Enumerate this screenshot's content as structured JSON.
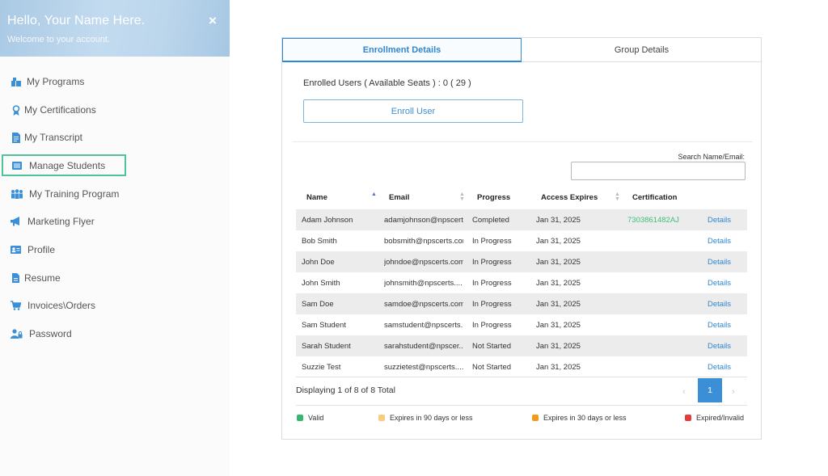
{
  "sidebar": {
    "greeting": "Hello, Your Name Here.",
    "welcome": "Welcome to your account.",
    "close_glyph": "×",
    "items": [
      {
        "label": "My Programs",
        "icon": "boxes-icon"
      },
      {
        "label": "My Certifications",
        "icon": "award-icon"
      },
      {
        "label": "My Transcript",
        "icon": "document-icon"
      },
      {
        "label": "Manage Students",
        "icon": "list-icon",
        "active": true
      },
      {
        "label": "My Training Program",
        "icon": "group-icon"
      },
      {
        "label": "Marketing Flyer",
        "icon": "megaphone-icon"
      },
      {
        "label": "Profile",
        "icon": "id-card-icon"
      },
      {
        "label": "Resume",
        "icon": "file-icon"
      },
      {
        "label": "Invoices\\Orders",
        "icon": "cart-icon"
      },
      {
        "label": "Password",
        "icon": "user-lock-icon"
      }
    ]
  },
  "tabs": [
    "Enrollment Details",
    "Group Details"
  ],
  "enrolled_text": "Enrolled Users ( Available Seats ) : 0 ( 29 )",
  "enroll_button": "Enroll User",
  "search": {
    "label": "Search Name/Email:",
    "value": "",
    "placeholder": ""
  },
  "table": {
    "headers": [
      "Name",
      "Email",
      "Progress",
      "Access Expires",
      "Certification"
    ],
    "rows": [
      {
        "name": "Adam Johnson",
        "email": "adamjohnson@npscert...",
        "progress": "Completed",
        "expires": "Jan 31, 2025",
        "cert": "7303861482AJ",
        "action": "Details"
      },
      {
        "name": "Bob Smith",
        "email": "bobsmith@npscerts.com",
        "progress": "In Progress",
        "expires": "Jan 31, 2025",
        "cert": "",
        "action": "Details"
      },
      {
        "name": "John Doe",
        "email": "johndoe@npscerts.com",
        "progress": "In Progress",
        "expires": "Jan 31, 2025",
        "cert": "",
        "action": "Details"
      },
      {
        "name": "John Smith",
        "email": "johnsmith@npscerts....",
        "progress": "In Progress",
        "expires": "Jan 31, 2025",
        "cert": "",
        "action": "Details"
      },
      {
        "name": "Sam Doe",
        "email": "samdoe@npscerts.com",
        "progress": "In Progress",
        "expires": "Jan 31, 2025",
        "cert": "",
        "action": "Details"
      },
      {
        "name": "Sam Student",
        "email": "samstudent@npscerts...",
        "progress": "In Progress",
        "expires": "Jan 31, 2025",
        "cert": "",
        "action": "Details"
      },
      {
        "name": "Sarah Student",
        "email": "sarahstudent@npscer...",
        "progress": "Not Started",
        "expires": "Jan 31, 2025",
        "cert": "",
        "action": "Details"
      },
      {
        "name": "Suzzie Test",
        "email": "suzzietest@npscerts....",
        "progress": "Not Started",
        "expires": "Jan 31, 2025",
        "cert": "",
        "action": "Details"
      }
    ]
  },
  "pagination": {
    "summary": "Displaying 1 of 8 of 8 Total",
    "prev": "‹",
    "current": "1",
    "next": "›"
  },
  "legend": [
    {
      "label": "Valid",
      "color": "#34b86e"
    },
    {
      "label": "Expires in 90 days or less",
      "color": "#f7cc80"
    },
    {
      "label": "Expires in 30 days or less",
      "color": "#f49a1b"
    },
    {
      "label": "Expired/Invalid",
      "color": "#e53b3b"
    }
  ]
}
